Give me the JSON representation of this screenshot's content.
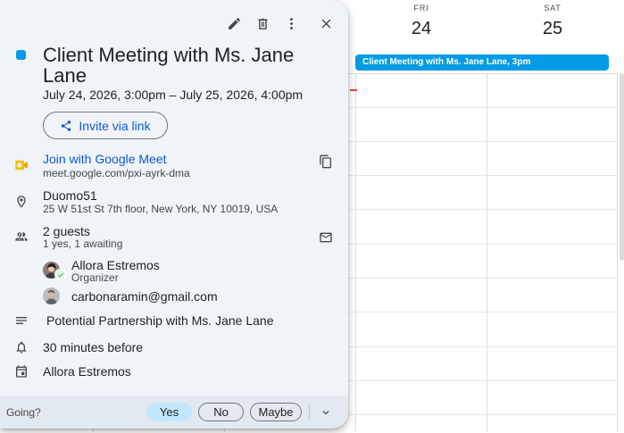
{
  "calendar": {
    "days": [
      {
        "name": "FRI",
        "number": "24"
      },
      {
        "name": "SAT",
        "number": "25"
      }
    ],
    "event_chip": "Client Meeting with Ms. Jane Lane, 3pm",
    "event_color": "#039be5"
  },
  "popup": {
    "toolbar": {
      "edit_icon": "pencil-icon",
      "delete_icon": "trash-icon",
      "more_icon": "more-vert-icon",
      "close_icon": "close-icon"
    },
    "title": "Client Meeting with Ms. Jane Lane",
    "datetime": "July 24, 2026, 3:00pm – July 25, 2026, 4:00pm",
    "invite_label": "Invite via link",
    "meet": {
      "join_label": "Join with Google Meet",
      "url": "meet.google.com/pxi-ayrk-dma"
    },
    "location": {
      "name": "Duomo51",
      "address": "25 W 51st St 7th floor, New York, NY 10019, USA"
    },
    "guests": {
      "count_label": "2 guests",
      "status": "1 yes, 1 awaiting",
      "list": [
        {
          "name": "Allora Estremos",
          "role": "Organizer"
        },
        {
          "name": "carbonaramin@gmail.com",
          "role": ""
        }
      ]
    },
    "description": "Potential Partnership with Ms. Jane Lane",
    "reminder": "30 minutes before",
    "calendar_owner": "Allora Estremos",
    "rsvp": {
      "prompt": "Going?",
      "yes": "Yes",
      "no": "No",
      "maybe": "Maybe",
      "selected": "Yes"
    },
    "colors": {
      "accent": "#0b57d0",
      "meet_icon": "#fbbc04",
      "selected_rsvp": "#c2e7ff"
    }
  }
}
